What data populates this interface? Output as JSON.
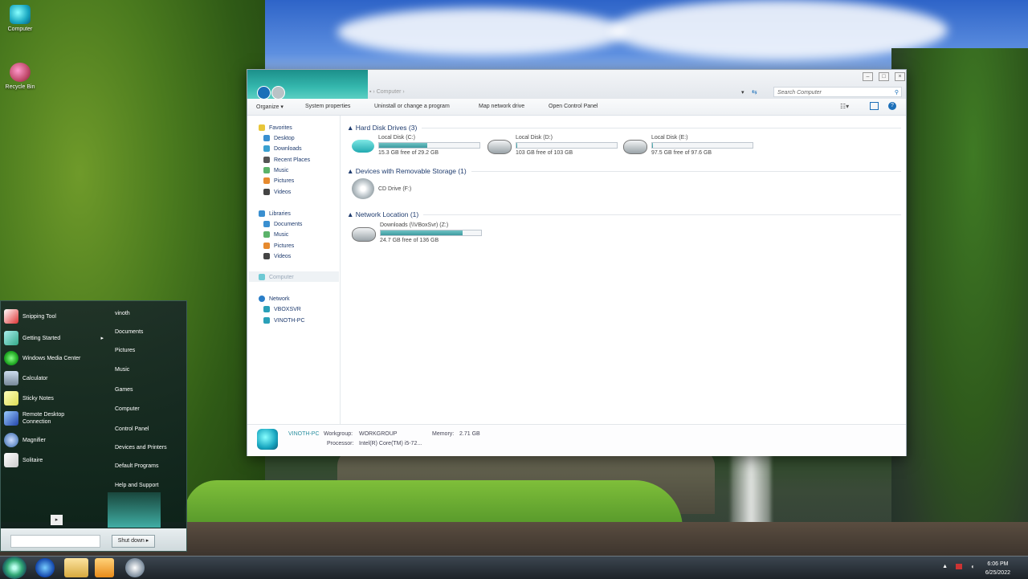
{
  "desktop": {
    "icons": [
      {
        "label": "Computer",
        "icon": "computer-icon"
      },
      {
        "label": "Recycle Bin",
        "icon": "recycle-bin-icon"
      }
    ]
  },
  "explorer": {
    "address": "Computer",
    "search_placeholder": "Search Computer",
    "toolbar": [
      "Organize ▾",
      "System properties",
      "Uninstall or change a program",
      "Map network drive",
      "Open Control Panel"
    ],
    "nav": {
      "favorites": "Favorites",
      "favorites_items": [
        "Desktop",
        "Downloads",
        "Recent Places",
        "Music",
        "Pictures",
        "Videos"
      ],
      "libraries": "Libraries",
      "libraries_items": [
        "Documents",
        "Music",
        "Pictures",
        "Videos"
      ],
      "computer": "Computer",
      "network": "Network",
      "network_items": [
        "VBOXSVR",
        "VINOTH-PC"
      ]
    },
    "groups": {
      "hdd_title": "Hard Disk Drives (3)",
      "removable_title": "Devices with Removable Storage (1)",
      "network_title": "Network Location (1)"
    },
    "drives": [
      {
        "name": "Local Disk (C:)",
        "free": "15.3 GB free of 29.2 GB",
        "used_pct": 47.6
      },
      {
        "name": "Local Disk (D:)",
        "free": "103 GB free of 103 GB",
        "used_pct": 0.5
      },
      {
        "name": "Local Disk (E:)",
        "free": "97.5 GB free of 97.6 GB",
        "used_pct": 0.5
      }
    ],
    "cd_drive": "CD Drive (F:)",
    "network_drive": {
      "name": "Downloads (\\\\VBoxSvr) (Z:)",
      "free": "24.7 GB free of 136 GB",
      "used_pct": 81.8
    },
    "details": {
      "pc_name": "VINOTH-PC",
      "workgroup_label": "Workgroup:",
      "workgroup": "WORKGROUP",
      "memory_label": "Memory:",
      "memory": "2.71 GB",
      "processor_label": "Processor:",
      "processor": "Intel(R) Core(TM) i5-72..."
    }
  },
  "start_menu": {
    "programs": [
      "Snipping Tool",
      "Getting Started",
      "Windows Media Center",
      "Calculator",
      "Sticky Notes",
      "Remote Desktop Connection",
      "Magnifier",
      "Solitaire"
    ],
    "links": [
      "vinoth",
      "Documents",
      "Pictures",
      "Music",
      "Games",
      "Computer",
      "Control Panel",
      "Devices and Printers",
      "Default Programs",
      "Help and Support"
    ],
    "shutdown": "Shut down",
    "shutdown_arrow": "▸"
  },
  "taskbar": {
    "time": "6:06 PM",
    "date": "6/25/2022"
  },
  "colors": {
    "accent": "#35b8ae",
    "nav_text": "#1e3b6e",
    "bar_fill": "#3e9aa0"
  }
}
